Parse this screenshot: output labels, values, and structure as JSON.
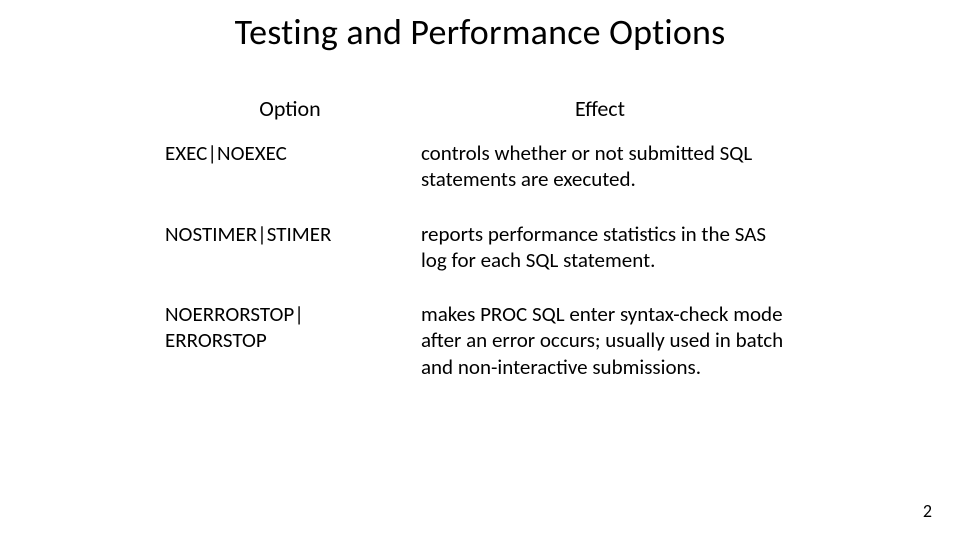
{
  "title": "Testing and Performance Options",
  "headers": {
    "option": "Option",
    "effect": "Effect"
  },
  "rows": [
    {
      "option": "EXEC|NOEXEC",
      "effect": "controls whether or not submitted SQL statements are executed."
    },
    {
      "option": "NOSTIMER|STIMER",
      "effect": "reports performance statistics in the SAS log for each SQL statement."
    },
    {
      "option": "NOERRORSTOP|\nERRORSTOP",
      "effect": "makes PROC SQL enter syntax-check mode after an error occurs; usually used in batch and non-interactive submissions."
    }
  ],
  "page_number": "2"
}
